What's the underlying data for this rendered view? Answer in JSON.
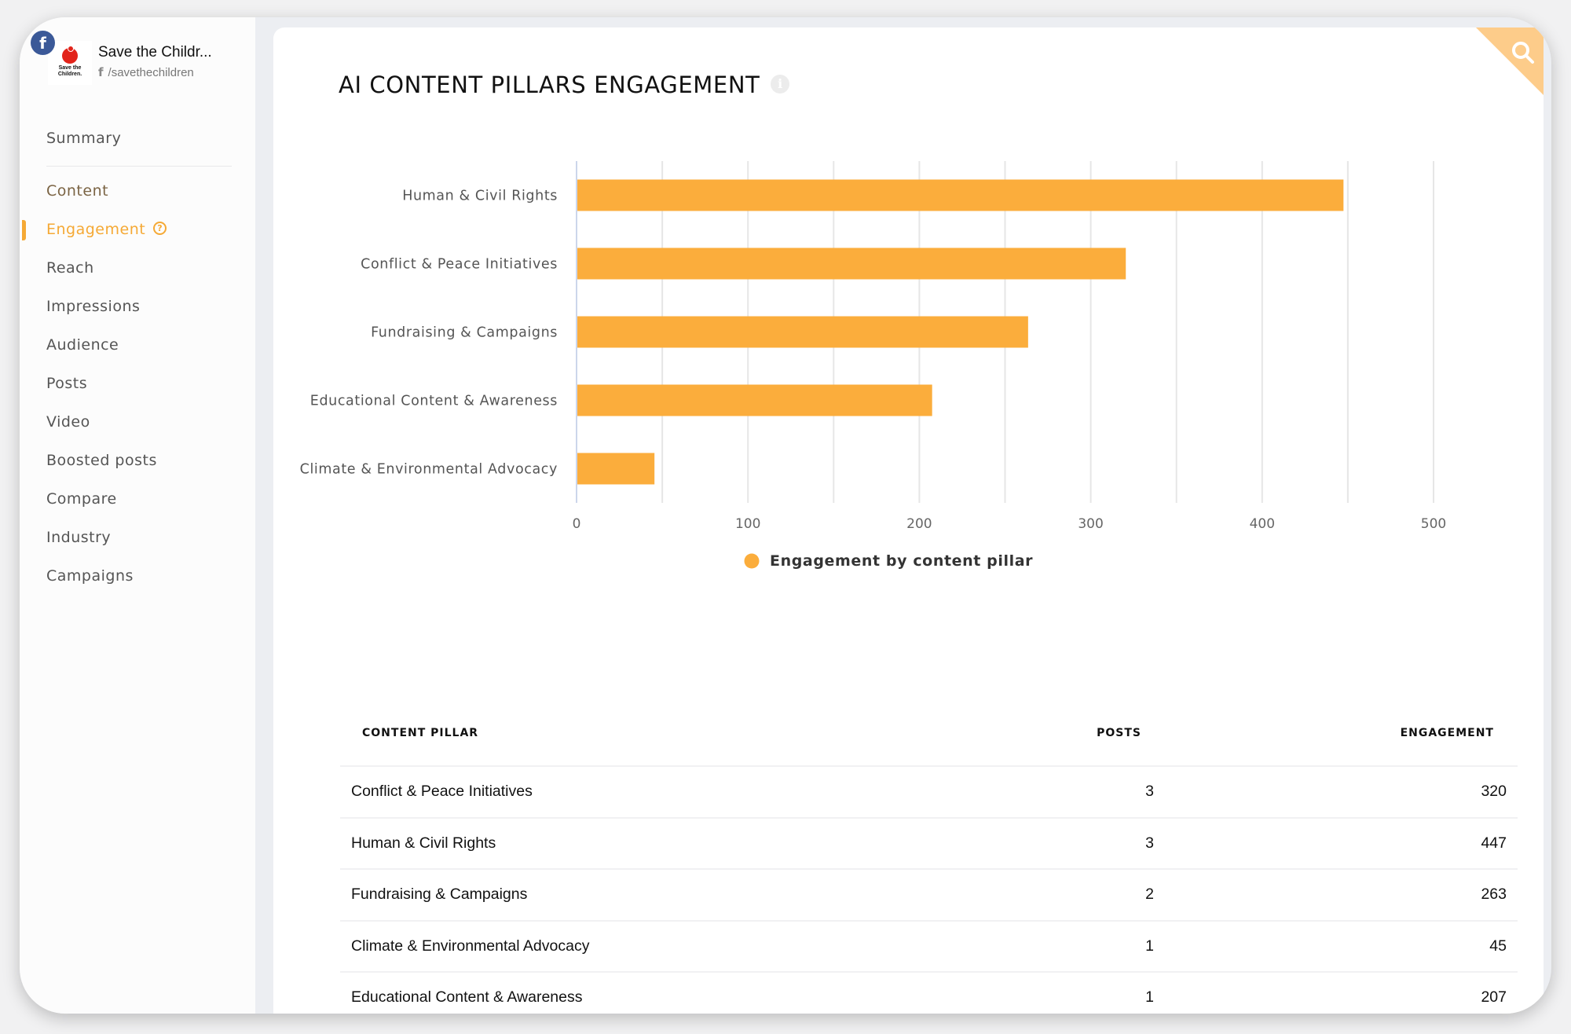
{
  "sidebar": {
    "account": {
      "name": "Save the Childr...",
      "handle": "/savethechildren",
      "platform_icon": "facebook-icon",
      "logo_text": "Save the Children."
    },
    "items": [
      {
        "label": "Summary"
      },
      {
        "label": "Content"
      },
      {
        "label": "Engagement",
        "active": true
      },
      {
        "label": "Reach"
      },
      {
        "label": "Impressions"
      },
      {
        "label": "Audience"
      },
      {
        "label": "Posts"
      },
      {
        "label": "Video"
      },
      {
        "label": "Boosted posts"
      },
      {
        "label": "Compare"
      },
      {
        "label": "Industry"
      },
      {
        "label": "Campaigns"
      }
    ]
  },
  "main": {
    "title": "AI CONTENT PILLARS ENGAGEMENT",
    "search_icon": "search-icon",
    "info_icon": "info-icon"
  },
  "colors": {
    "accent": "#f5a935",
    "bar": "#fbad3c",
    "corner": "#fdcc8a",
    "facebook": "#3b5998"
  },
  "chart_data": {
    "type": "bar",
    "orientation": "horizontal",
    "title": "",
    "categories": [
      "Human & Civil Rights",
      "Conflict & Peace Initiatives",
      "Fundraising & Campaigns",
      "Educational Content & Awareness",
      "Climate & Environmental Advocacy"
    ],
    "series": [
      {
        "name": "Engagement by content pillar",
        "values": [
          447,
          320,
          263,
          207,
          45
        ]
      }
    ],
    "xlabel": "",
    "ylabel": "",
    "xlim": [
      0,
      500
    ],
    "xticks": [
      0,
      100,
      200,
      300,
      400,
      500
    ],
    "grid": true,
    "legend": "bottom-center"
  },
  "table": {
    "headers": [
      "CONTENT PILLAR",
      "POSTS",
      "ENGAGEMENT"
    ],
    "rows": [
      {
        "pillar": "Conflict & Peace Initiatives",
        "posts": "3",
        "engagement": "320"
      },
      {
        "pillar": "Human & Civil Rights",
        "posts": "3",
        "engagement": "447"
      },
      {
        "pillar": "Fundraising & Campaigns",
        "posts": "2",
        "engagement": "263"
      },
      {
        "pillar": "Climate & Environmental Advocacy",
        "posts": "1",
        "engagement": "45"
      },
      {
        "pillar": "Educational Content & Awareness",
        "posts": "1",
        "engagement": "207"
      }
    ]
  }
}
